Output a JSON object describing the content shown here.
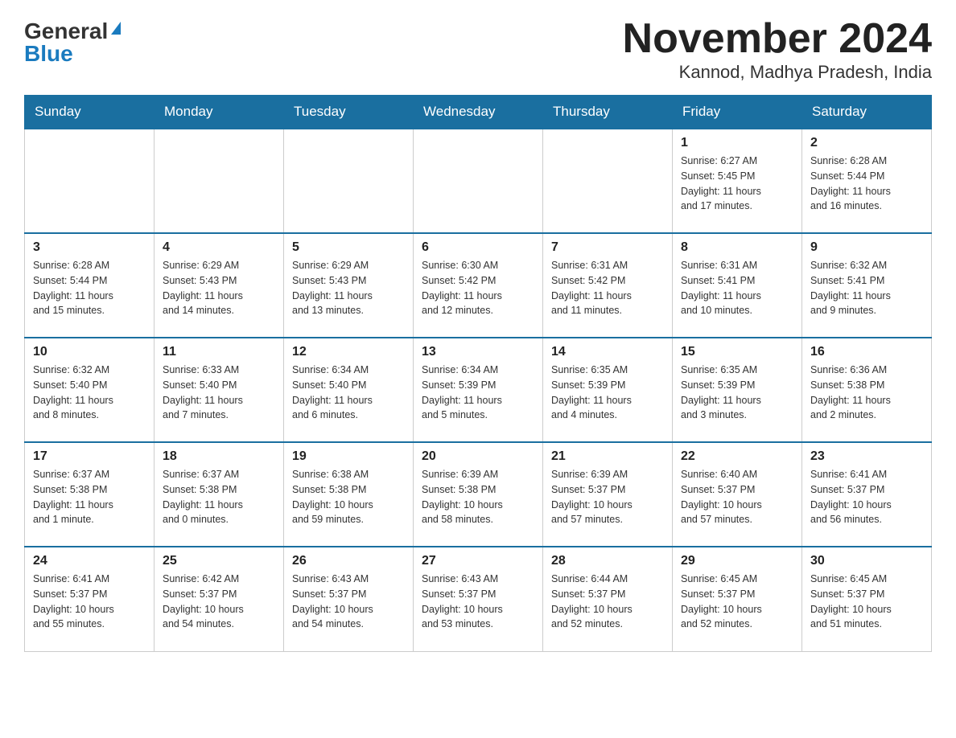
{
  "header": {
    "logo_general": "General",
    "logo_blue": "Blue",
    "month_title": "November 2024",
    "location": "Kannod, Madhya Pradesh, India"
  },
  "days_of_week": [
    "Sunday",
    "Monday",
    "Tuesday",
    "Wednesday",
    "Thursday",
    "Friday",
    "Saturday"
  ],
  "weeks": [
    [
      {
        "day": "",
        "info": ""
      },
      {
        "day": "",
        "info": ""
      },
      {
        "day": "",
        "info": ""
      },
      {
        "day": "",
        "info": ""
      },
      {
        "day": "",
        "info": ""
      },
      {
        "day": "1",
        "info": "Sunrise: 6:27 AM\nSunset: 5:45 PM\nDaylight: 11 hours\nand 17 minutes."
      },
      {
        "day": "2",
        "info": "Sunrise: 6:28 AM\nSunset: 5:44 PM\nDaylight: 11 hours\nand 16 minutes."
      }
    ],
    [
      {
        "day": "3",
        "info": "Sunrise: 6:28 AM\nSunset: 5:44 PM\nDaylight: 11 hours\nand 15 minutes."
      },
      {
        "day": "4",
        "info": "Sunrise: 6:29 AM\nSunset: 5:43 PM\nDaylight: 11 hours\nand 14 minutes."
      },
      {
        "day": "5",
        "info": "Sunrise: 6:29 AM\nSunset: 5:43 PM\nDaylight: 11 hours\nand 13 minutes."
      },
      {
        "day": "6",
        "info": "Sunrise: 6:30 AM\nSunset: 5:42 PM\nDaylight: 11 hours\nand 12 minutes."
      },
      {
        "day": "7",
        "info": "Sunrise: 6:31 AM\nSunset: 5:42 PM\nDaylight: 11 hours\nand 11 minutes."
      },
      {
        "day": "8",
        "info": "Sunrise: 6:31 AM\nSunset: 5:41 PM\nDaylight: 11 hours\nand 10 minutes."
      },
      {
        "day": "9",
        "info": "Sunrise: 6:32 AM\nSunset: 5:41 PM\nDaylight: 11 hours\nand 9 minutes."
      }
    ],
    [
      {
        "day": "10",
        "info": "Sunrise: 6:32 AM\nSunset: 5:40 PM\nDaylight: 11 hours\nand 8 minutes."
      },
      {
        "day": "11",
        "info": "Sunrise: 6:33 AM\nSunset: 5:40 PM\nDaylight: 11 hours\nand 7 minutes."
      },
      {
        "day": "12",
        "info": "Sunrise: 6:34 AM\nSunset: 5:40 PM\nDaylight: 11 hours\nand 6 minutes."
      },
      {
        "day": "13",
        "info": "Sunrise: 6:34 AM\nSunset: 5:39 PM\nDaylight: 11 hours\nand 5 minutes."
      },
      {
        "day": "14",
        "info": "Sunrise: 6:35 AM\nSunset: 5:39 PM\nDaylight: 11 hours\nand 4 minutes."
      },
      {
        "day": "15",
        "info": "Sunrise: 6:35 AM\nSunset: 5:39 PM\nDaylight: 11 hours\nand 3 minutes."
      },
      {
        "day": "16",
        "info": "Sunrise: 6:36 AM\nSunset: 5:38 PM\nDaylight: 11 hours\nand 2 minutes."
      }
    ],
    [
      {
        "day": "17",
        "info": "Sunrise: 6:37 AM\nSunset: 5:38 PM\nDaylight: 11 hours\nand 1 minute."
      },
      {
        "day": "18",
        "info": "Sunrise: 6:37 AM\nSunset: 5:38 PM\nDaylight: 11 hours\nand 0 minutes."
      },
      {
        "day": "19",
        "info": "Sunrise: 6:38 AM\nSunset: 5:38 PM\nDaylight: 10 hours\nand 59 minutes."
      },
      {
        "day": "20",
        "info": "Sunrise: 6:39 AM\nSunset: 5:38 PM\nDaylight: 10 hours\nand 58 minutes."
      },
      {
        "day": "21",
        "info": "Sunrise: 6:39 AM\nSunset: 5:37 PM\nDaylight: 10 hours\nand 57 minutes."
      },
      {
        "day": "22",
        "info": "Sunrise: 6:40 AM\nSunset: 5:37 PM\nDaylight: 10 hours\nand 57 minutes."
      },
      {
        "day": "23",
        "info": "Sunrise: 6:41 AM\nSunset: 5:37 PM\nDaylight: 10 hours\nand 56 minutes."
      }
    ],
    [
      {
        "day": "24",
        "info": "Sunrise: 6:41 AM\nSunset: 5:37 PM\nDaylight: 10 hours\nand 55 minutes."
      },
      {
        "day": "25",
        "info": "Sunrise: 6:42 AM\nSunset: 5:37 PM\nDaylight: 10 hours\nand 54 minutes."
      },
      {
        "day": "26",
        "info": "Sunrise: 6:43 AM\nSunset: 5:37 PM\nDaylight: 10 hours\nand 54 minutes."
      },
      {
        "day": "27",
        "info": "Sunrise: 6:43 AM\nSunset: 5:37 PM\nDaylight: 10 hours\nand 53 minutes."
      },
      {
        "day": "28",
        "info": "Sunrise: 6:44 AM\nSunset: 5:37 PM\nDaylight: 10 hours\nand 52 minutes."
      },
      {
        "day": "29",
        "info": "Sunrise: 6:45 AM\nSunset: 5:37 PM\nDaylight: 10 hours\nand 52 minutes."
      },
      {
        "day": "30",
        "info": "Sunrise: 6:45 AM\nSunset: 5:37 PM\nDaylight: 10 hours\nand 51 minutes."
      }
    ]
  ]
}
